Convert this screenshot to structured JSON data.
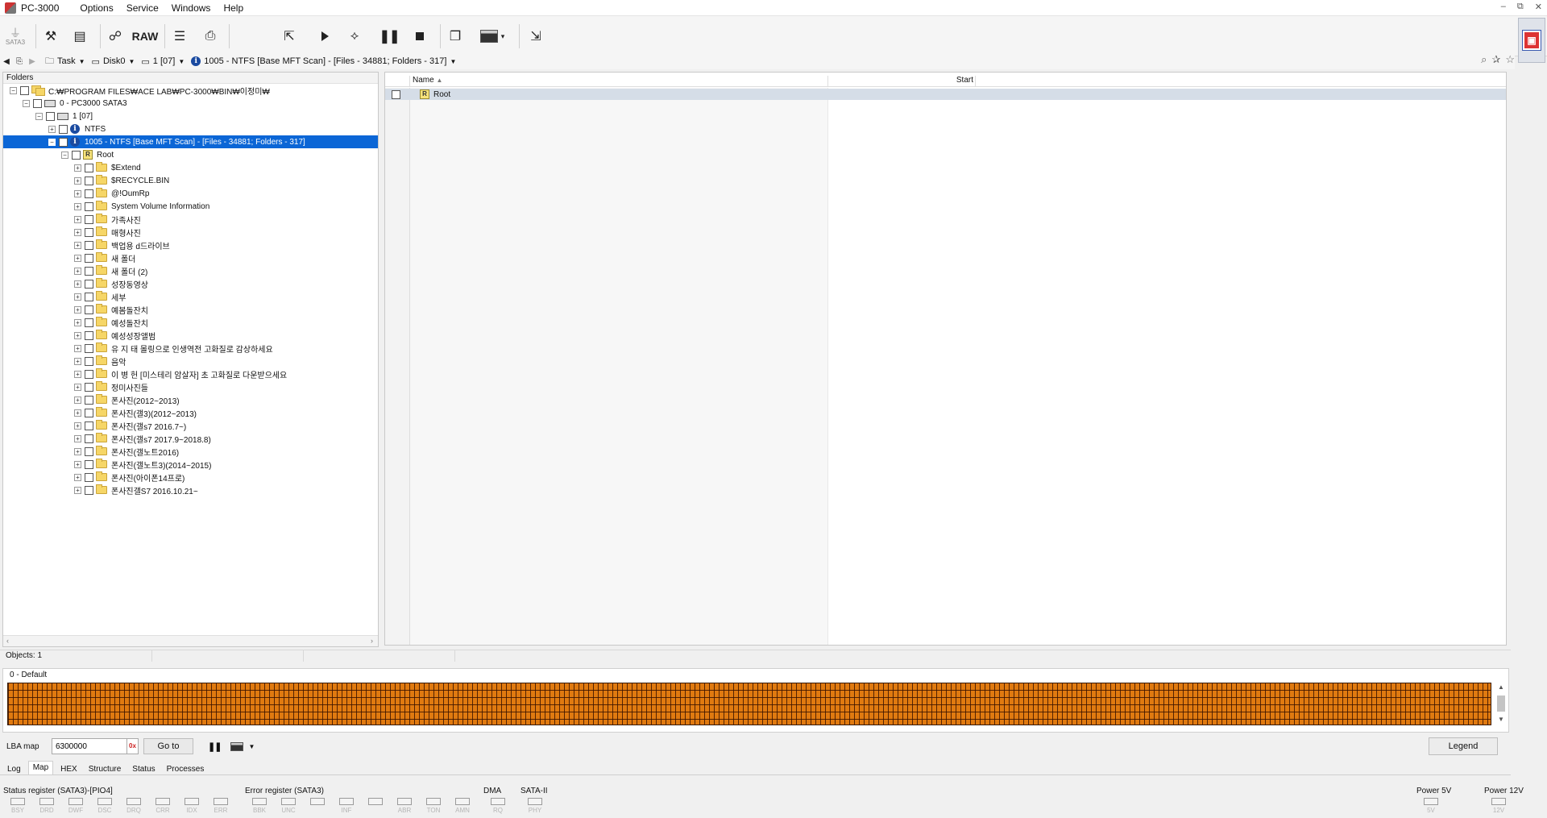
{
  "app": {
    "title": "PC-3000",
    "menu": [
      "Options",
      "Service",
      "Windows",
      "Help"
    ],
    "window_controls": [
      "–",
      "⧉",
      "✕"
    ]
  },
  "toolbar": {
    "sata_label": "SATA3",
    "raw_label": "RAW"
  },
  "navbar": {
    "task_label": "Task",
    "disk_label": "Disk0",
    "partition_label": "1 [07]",
    "scan_label": "1005 - NTFS [Base MFT Scan] - [Files - 34881; Folders - 317]"
  },
  "folders": {
    "header": "Folders",
    "tree": [
      {
        "label": "C:₩PROGRAM FILES₩ACE LAB₩PC-3000₩BIN₩이정미₩",
        "level": 0,
        "expander": "−",
        "icon": "multi"
      },
      {
        "label": "0 - PC3000 SATA3",
        "level": 1,
        "expander": "−",
        "icon": "disk"
      },
      {
        "label": "1 [07]",
        "level": 2,
        "expander": "−",
        "icon": "disk"
      },
      {
        "label": "NTFS",
        "level": 3,
        "expander": "+",
        "icon": "info"
      },
      {
        "label": "1005 - NTFS [Base MFT Scan] - [Files - 34881; Folders - 317]",
        "level": 3,
        "expander": "−",
        "icon": "info",
        "selected": true
      },
      {
        "label": "Root",
        "level": 4,
        "expander": "−",
        "icon": "root"
      },
      {
        "label": "$Extend",
        "level": 5,
        "expander": "+",
        "icon": "folder"
      },
      {
        "label": "$RECYCLE.BIN",
        "level": 5,
        "expander": "+",
        "icon": "folder"
      },
      {
        "label": "@!OumRp",
        "level": 5,
        "expander": "+",
        "icon": "folder"
      },
      {
        "label": "System Volume Information",
        "level": 5,
        "expander": "+",
        "icon": "folder"
      },
      {
        "label": "가족사진",
        "level": 5,
        "expander": "+",
        "icon": "folder"
      },
      {
        "label": "매형사진",
        "level": 5,
        "expander": "+",
        "icon": "folder"
      },
      {
        "label": "백업용 d드라이브",
        "level": 5,
        "expander": "+",
        "icon": "folder"
      },
      {
        "label": "새 폴더",
        "level": 5,
        "expander": "+",
        "icon": "folder"
      },
      {
        "label": "새 폴더 (2)",
        "level": 5,
        "expander": "+",
        "icon": "folder"
      },
      {
        "label": "성장동영상",
        "level": 5,
        "expander": "+",
        "icon": "folder"
      },
      {
        "label": "세부",
        "level": 5,
        "expander": "+",
        "icon": "folder"
      },
      {
        "label": "예봄돌잔치",
        "level": 5,
        "expander": "+",
        "icon": "folder"
      },
      {
        "label": "예성돌잔치",
        "level": 5,
        "expander": "+",
        "icon": "folder"
      },
      {
        "label": "예성성장앨범",
        "level": 5,
        "expander": "+",
        "icon": "folder"
      },
      {
        "label": "유 지 태 몰링으로 인생역전 고화질로 감상하세요",
        "level": 5,
        "expander": "+",
        "icon": "folder"
      },
      {
        "label": "음악",
        "level": 5,
        "expander": "+",
        "icon": "folder"
      },
      {
        "label": "이 병 헌 [미스테리 암살자] 초 고화질로 다운받으세요",
        "level": 5,
        "expander": "+",
        "icon": "folder"
      },
      {
        "label": "정미사진들",
        "level": 5,
        "expander": "+",
        "icon": "folder"
      },
      {
        "label": "폰사진(2012~2013)",
        "level": 5,
        "expander": "+",
        "icon": "folder"
      },
      {
        "label": "폰사진(갤3)(2012~2013)",
        "level": 5,
        "expander": "+",
        "icon": "folder"
      },
      {
        "label": "폰사진(갤s7 2016.7~)",
        "level": 5,
        "expander": "+",
        "icon": "folder"
      },
      {
        "label": "폰사진(갤s7 2017.9~2018.8)",
        "level": 5,
        "expander": "+",
        "icon": "folder"
      },
      {
        "label": "폰사진(갤노트2016)",
        "level": 5,
        "expander": "+",
        "icon": "folder"
      },
      {
        "label": "폰사진(갤노트3)(2014~2015)",
        "level": 5,
        "expander": "+",
        "icon": "folder"
      },
      {
        "label": "폰사진(아이폰14프로)",
        "level": 5,
        "expander": "+",
        "icon": "folder"
      },
      {
        "label": "폰사진갤S7 2016.10.21~",
        "level": 5,
        "expander": "+",
        "icon": "folder"
      }
    ]
  },
  "list": {
    "columns": {
      "name": "Name",
      "start": "Start"
    },
    "rows": [
      {
        "name": "Root"
      }
    ]
  },
  "status": {
    "objects": "Objects: 1"
  },
  "map": {
    "title": "0 - Default",
    "cell_color": "#e07a10"
  },
  "lba": {
    "label": "LBA map",
    "value": "6300000",
    "goto_label": "Go to",
    "legend_label": "Legend"
  },
  "tabs": [
    {
      "label": "Log",
      "active": false
    },
    {
      "label": "Map",
      "active": true
    },
    {
      "label": "HEX",
      "active": false
    },
    {
      "label": "Structure",
      "active": false
    },
    {
      "label": "Status",
      "active": false
    },
    {
      "label": "Processes",
      "active": false
    }
  ],
  "registers": {
    "status_title": "Status register (SATA3)-[PIO4]",
    "status_bits": [
      "BSY",
      "DRD",
      "DWF",
      "DSC",
      "DRQ",
      "CRR",
      "IDX",
      "ERR"
    ],
    "error_title": "Error register (SATA3)",
    "error_bits": [
      "BBK",
      "UNC",
      "",
      "INF",
      "",
      "ABR",
      "TON",
      "AMN"
    ],
    "dma_title": "DMA",
    "dma_bits": [
      "RQ"
    ],
    "sata_title": "SATA-II",
    "sata_bits": [
      "PHY"
    ],
    "power5_title": "Power 5V",
    "power5_bits": [
      "5V"
    ],
    "power12_title": "Power 12V",
    "power12_bits": [
      "12V"
    ]
  },
  "colors": {
    "selection": "#0b66d6",
    "map_cells": "#e07a10",
    "badge": "#d33"
  }
}
